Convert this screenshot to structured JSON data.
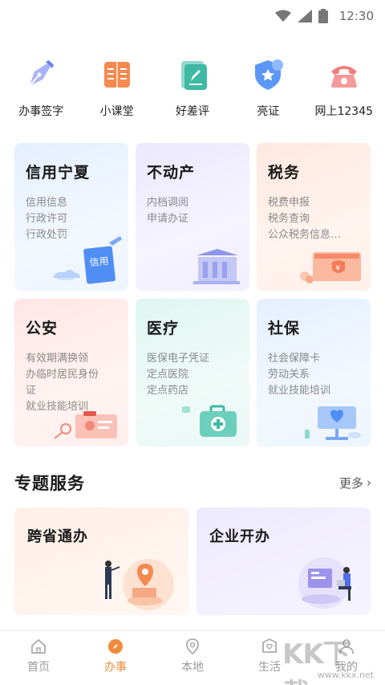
{
  "status_bar": {
    "time": "12:30"
  },
  "quick_actions": [
    {
      "label": "办事签字",
      "icon": "pen-icon",
      "color": "#7b8cf0"
    },
    {
      "label": "小课堂",
      "icon": "book-icon",
      "color": "#f0743a"
    },
    {
      "label": "好差评",
      "icon": "edit-note-icon",
      "color": "#3fb8a4"
    },
    {
      "label": "亮证",
      "icon": "shield-icon",
      "color": "#4a8cf5"
    },
    {
      "label": "网上12345",
      "icon": "phone-icon",
      "color": "#f06a6a"
    }
  ],
  "service_cards": [
    {
      "title": "信用宁夏",
      "lines": [
        "信用信息",
        "行政许可",
        "行政处罚"
      ],
      "badge": "信用"
    },
    {
      "title": "不动产",
      "lines": [
        "内档调阅",
        "申请办证"
      ]
    },
    {
      "title": "税务",
      "lines": [
        "税费申报",
        "税务查询",
        "公众税务信息…"
      ],
      "badge": "¥"
    },
    {
      "title": "公安",
      "lines": [
        "有效期满换领",
        "办临时居民身份",
        "证",
        "就业技能培训"
      ]
    },
    {
      "title": "医疗",
      "lines": [
        "医保电子凭证",
        "定点医院",
        "定点药店"
      ]
    },
    {
      "title": "社保",
      "lines": [
        "社会保障卡",
        "劳动关系",
        "就业技能培训"
      ]
    }
  ],
  "section": {
    "title": "专题服务",
    "more": "更多"
  },
  "topics": [
    {
      "title": "跨省通办"
    },
    {
      "title": "企业开办"
    }
  ],
  "tabs": [
    {
      "label": "首页",
      "icon": "home-icon"
    },
    {
      "label": "办事",
      "icon": "compass-icon",
      "active": true
    },
    {
      "label": "本地",
      "icon": "location-icon"
    },
    {
      "label": "生活",
      "icon": "house-heart-icon"
    },
    {
      "label": "我的",
      "icon": "person-icon"
    }
  ],
  "watermark": {
    "text": "KK下载",
    "url": "www.kkx.net"
  },
  "colors": {
    "accent": "#f08a3a",
    "muted": "#999999"
  }
}
